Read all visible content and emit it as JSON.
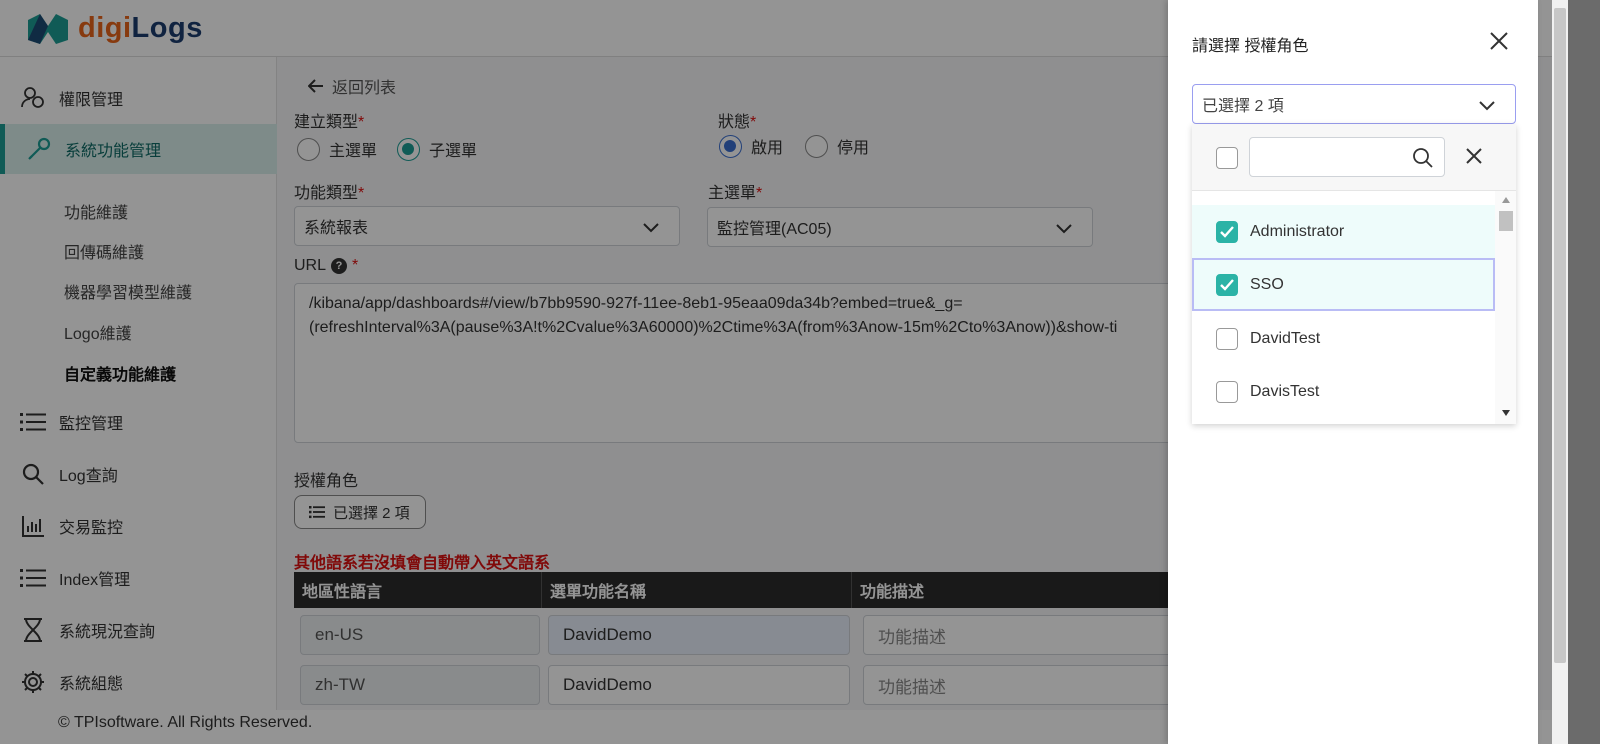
{
  "brand": {
    "name_part1": "digi",
    "name_part2": "Logs",
    "colors": {
      "orange": "#e8641b",
      "navy": "#1c3d6e",
      "teal": "#1d9d95"
    }
  },
  "sidebar": {
    "items": [
      {
        "label": "權限管理",
        "icon": "users-icon"
      },
      {
        "label": "系統功能管理",
        "icon": "wrench-icon",
        "active": true
      },
      {
        "label": "監控管理",
        "icon": "list-icon"
      },
      {
        "label": "Log查詢",
        "icon": "search-icon"
      },
      {
        "label": "交易監控",
        "icon": "bar-chart-icon"
      },
      {
        "label": "Index管理",
        "icon": "list-icon"
      },
      {
        "label": "系統現況查詢",
        "icon": "hourglass-icon"
      },
      {
        "label": "系統組態",
        "icon": "gear-icon"
      }
    ],
    "sub_items": [
      {
        "label": "功能維護"
      },
      {
        "label": "回傳碼維護"
      },
      {
        "label": "機器學習模型維護"
      },
      {
        "label": "Logo維護"
      },
      {
        "label": "自定義功能維護",
        "current": true
      }
    ]
  },
  "form": {
    "back_label": "返回列表",
    "create_type_label": "建立類型",
    "create_type_options": [
      "主選單",
      "子選單"
    ],
    "status_label": "狀態",
    "status_options": [
      "啟用",
      "停用"
    ],
    "function_type_label": "功能類型",
    "function_type_value": "系統報表",
    "main_menu_label": "主選單",
    "main_menu_value": "監控管理(AC05)",
    "url_label": "URL",
    "url_value": "/kibana/app/dashboards#/view/b7bb9590-927f-11ee-8eb1-95eaa09da34b?embed=true&_g=\n(refreshInterval%3A(pause%3A!t%2Cvalue%3A60000)%2Ctime%3A(from%3Anow-15m%2Cto%3Anow))&show-ti",
    "roles_label": "授權角色",
    "roles_button": "已選擇 2 項",
    "warning": "其他語系若沒填會自動帶入英文語系",
    "table_headers": [
      "地區性語言",
      "選單功能名稱",
      "功能描述"
    ],
    "rows": [
      {
        "lang": "en-US",
        "name": "DavidDemo",
        "desc_placeholder": "功能描述"
      },
      {
        "lang": "zh-TW",
        "name": "DavidDemo",
        "desc_placeholder": "功能描述"
      }
    ],
    "required_mark": "*"
  },
  "footer": {
    "text": "© TPIsoftware. All Rights Reserved."
  },
  "drawer": {
    "title": "請選擇 授權角色",
    "select_value": "已選擇 2 項",
    "search_placeholder": "",
    "options": [
      {
        "label": "Administrator",
        "checked": true
      },
      {
        "label": "SSO",
        "checked": true
      },
      {
        "label": "DavidTest",
        "checked": false
      },
      {
        "label": "DavisTest",
        "checked": false
      }
    ]
  }
}
